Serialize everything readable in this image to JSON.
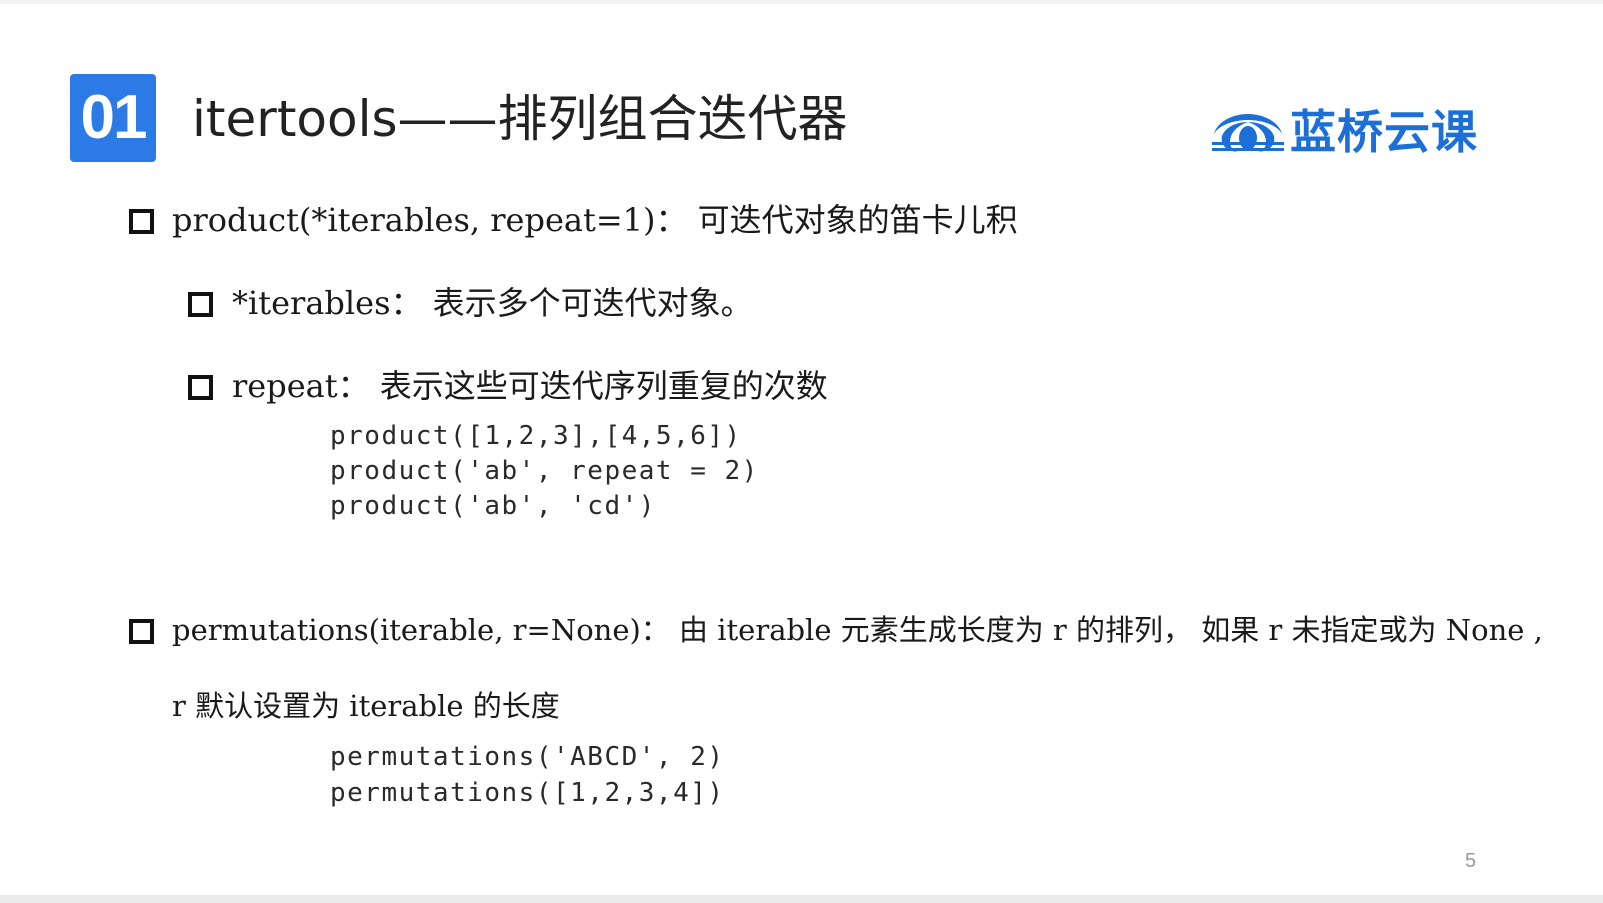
{
  "slide": {
    "section_number": "01",
    "title": "itertools——排列组合迭代器",
    "logo_text": "蓝桥云课",
    "page_number": "5",
    "accent_color": "#2b7ae6",
    "logo_color": "#1d6fd8"
  },
  "bullets": {
    "product": "product(*iterables, repeat=1)： 可迭代对象的笛卡儿积",
    "iterables": "*iterables：  表示多个可迭代对象。",
    "repeat": "repeat： 表示这些可迭代序列重复的次数",
    "permutations_line1": "permutations(iterable, r=None)： 由 iterable 元素生成长度为 r 的排列， 如果 r 未指定或为 None ,",
    "permutations_line2": "r 默认设置为 iterable 的长度"
  },
  "code": {
    "product_examples": [
      "product([1,2,3],[4,5,6])",
      "product('ab', repeat = 2)",
      "product('ab', 'cd')"
    ],
    "permutations_examples": [
      "permutations('ABCD', 2)",
      "permutations([1,2,3,4])"
    ]
  },
  "icons": {
    "bullet": "square-bullet-icon",
    "logo": "lanqiao-logo-icon"
  }
}
